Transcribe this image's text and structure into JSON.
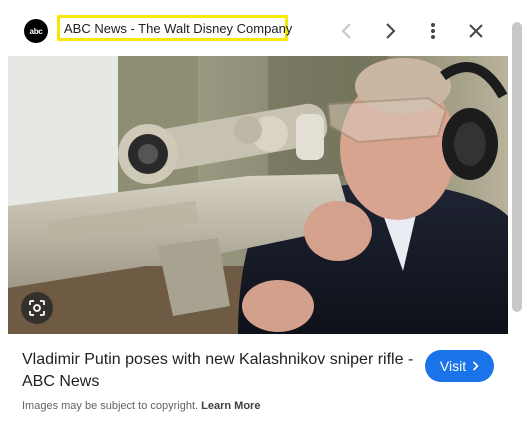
{
  "header": {
    "source_logo_text": "abc",
    "source_title": "ABC News - The Walt Disney Company",
    "icons": {
      "prev": "chevron-left-icon",
      "next": "chevron-right-icon",
      "more": "more-vert-icon",
      "close": "close-icon"
    }
  },
  "image": {
    "lens_icon": "google-lens-icon"
  },
  "caption": {
    "title": "Vladimir Putin poses with new Kalashnikov sniper rifle - ABC News",
    "visit_label": "Visit",
    "copyright_text": "Images may be subject to copyright.",
    "learn_more": "Learn More"
  },
  "colors": {
    "accent": "#1a73e8",
    "highlight_border": "#f5e90a"
  }
}
